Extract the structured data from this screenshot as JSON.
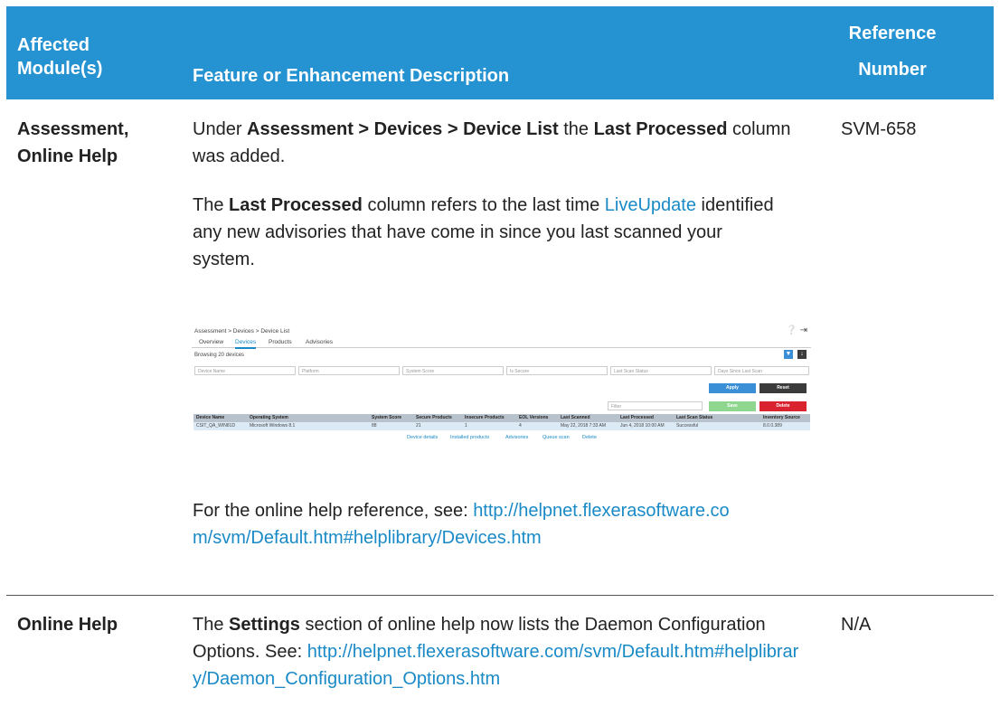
{
  "header": {
    "col1": "Affected Module(s)",
    "col2": "Feature or Enhancement Description",
    "col3_line1": "Reference",
    "col3_line2": "Number"
  },
  "rows": [
    {
      "module": "Assessment, Online Help",
      "p1_prefix": "Under ",
      "p1_bold1": "Assessment > Devices > Device List",
      "p1_mid": " the ",
      "p1_bold2": "Last Processed",
      "p1_suffix": " column was added.",
      "p2_prefix": "The ",
      "p2_bold": "Last Processed",
      "p2_mid": " column refers to the last time ",
      "p2_link": "LiveUpdate",
      "p2_suffix": " identified any new advisories that have come in since you last scanned your system.",
      "p3_prefix": "For the online help reference, see: ",
      "p3_link": "http://helpnet.flexerasoftware.com/svm/Default.htm#helplibrary/Devices.htm",
      "reference": "SVM-658"
    },
    {
      "module": "Online Help",
      "p1_prefix": "The ",
      "p1_bold": "Settings",
      "p1_suffix": " section of online help now lists the Daemon Configuration Options. See: ",
      "p1_link": "http://helpnet.flexerasoftware.com/svm/Default.htm#helplibrary/Daemon_Configuration_Options.htm",
      "reference": "N/A"
    }
  ],
  "screenshot": {
    "breadcrumb": "Assessment > Devices > Device List",
    "tabs": [
      "Overview",
      "Devices",
      "Products",
      "Advisories"
    ],
    "browsing": "Browsing 20 devices",
    "filters": [
      "Device Name",
      "Platform",
      "System Score",
      "Is Secure",
      "Last Scan Status",
      "Days Since Last Scan"
    ],
    "filter_box": "Filter",
    "buttons": {
      "apply": "Apply",
      "reset": "Reset",
      "save": "Save",
      "delete": "Delete"
    },
    "columns": [
      "Device Name",
      "Operating System",
      "System Score",
      "Secure Products",
      "Insecure Products",
      "EOL Versions",
      "Last Scanned",
      "Last Processed",
      "Last Scan Status",
      "Inventory Source"
    ],
    "row": [
      "CSIT_QA_WIN81D",
      "Microsoft Windows 8.1",
      "88",
      "21",
      "1",
      "4",
      "May 22, 2018 7:33 AM",
      "Jun 4, 2018 10:00 AM",
      "Successful",
      "8.0.0.389"
    ],
    "row_actions": [
      "Device details",
      "Installed products",
      "Advisories",
      "Queue scan",
      "Delete"
    ],
    "colors": {
      "accent": "#1a8ac7",
      "apply": "#3a8fd6",
      "reset": "#3b3b3b",
      "save": "#8fd68f",
      "delete": "#d9232e"
    }
  }
}
